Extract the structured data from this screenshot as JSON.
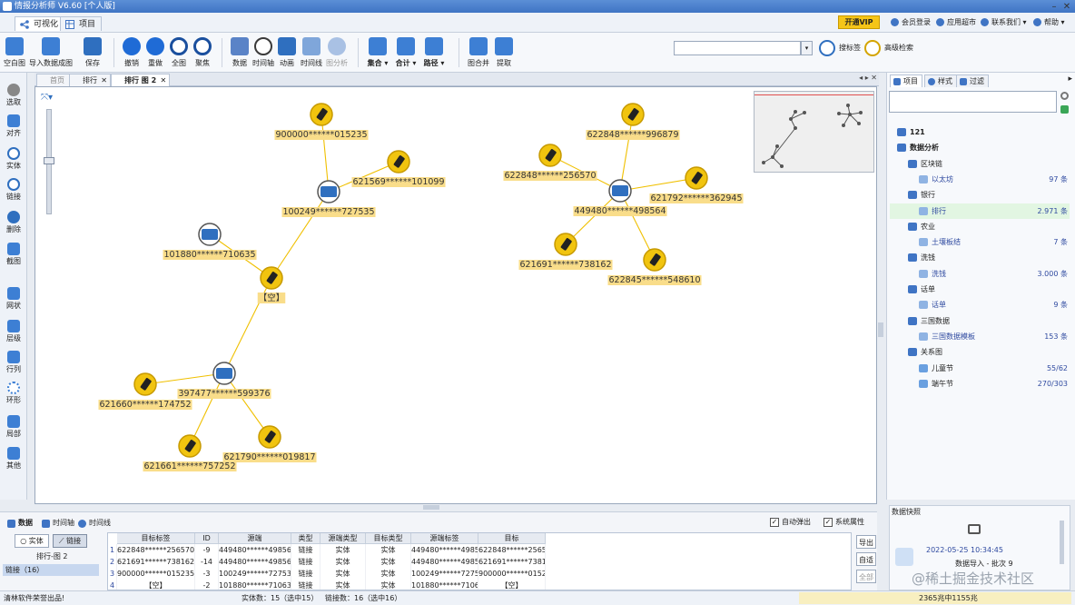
{
  "window": {
    "title": "情报分析师 V6.60 [个人版]"
  },
  "menubar": {
    "tabs": [
      {
        "label": "可视化"
      },
      {
        "label": "项目"
      }
    ],
    "vip": "开通VIP",
    "links": [
      {
        "label": "会员登录"
      },
      {
        "label": "应用超市"
      },
      {
        "label": "联系我们"
      },
      {
        "label": "帮助"
      }
    ]
  },
  "toolbar": {
    "buttons": [
      {
        "label": "空白图"
      },
      {
        "label": "导入数据成图"
      },
      {
        "label": "保存"
      },
      {
        "label": "撤销"
      },
      {
        "label": "重做"
      },
      {
        "label": "全图"
      },
      {
        "label": "聚焦"
      },
      {
        "label": "数据"
      },
      {
        "label": "时间轴"
      },
      {
        "label": "动画"
      },
      {
        "label": "时间线"
      },
      {
        "label": "图分析"
      },
      {
        "label": "集合"
      },
      {
        "label": "合计"
      },
      {
        "label": "路径"
      },
      {
        "label": "图合并"
      },
      {
        "label": "提取"
      }
    ],
    "search_value": "",
    "tag_search": "搜标签",
    "advanced_search": "高级检索"
  },
  "left_tools": [
    {
      "label": "选取"
    },
    {
      "label": "对齐"
    },
    {
      "label": "实体"
    },
    {
      "label": "链接"
    },
    {
      "label": "删除"
    },
    {
      "label": "截图"
    },
    {
      "label": "网状"
    },
    {
      "label": "层级"
    },
    {
      "label": "行列"
    },
    {
      "label": "环形"
    },
    {
      "label": "局部"
    },
    {
      "label": "其他"
    }
  ],
  "doc_tabs": [
    {
      "label": "首页"
    },
    {
      "label": "排行"
    },
    {
      "label": "排行 图 2"
    }
  ],
  "graph": {
    "nodes": [
      {
        "id": "n1",
        "label": "900000******015235",
        "type": "phone"
      },
      {
        "id": "n2",
        "label": "621569******101099",
        "type": "phone"
      },
      {
        "id": "n3",
        "label": "100249******727535",
        "type": "card"
      },
      {
        "id": "n4",
        "label": "101880******710635",
        "type": "card"
      },
      {
        "id": "n5",
        "label": "【空】",
        "type": "phone"
      },
      {
        "id": "n6",
        "label": "397477******599376",
        "type": "card"
      },
      {
        "id": "n7",
        "label": "621660******174752",
        "type": "phone"
      },
      {
        "id": "n8",
        "label": "621661******757252",
        "type": "phone"
      },
      {
        "id": "n9",
        "label": "621790******019817",
        "type": "phone"
      },
      {
        "id": "n10",
        "label": "622848******996879",
        "type": "phone"
      },
      {
        "id": "n11",
        "label": "622848******256570",
        "type": "phone"
      },
      {
        "id": "n12",
        "label": "449480******498564",
        "type": "card"
      },
      {
        "id": "n13",
        "label": "621792******362945",
        "type": "phone"
      },
      {
        "id": "n14",
        "label": "621691******738162",
        "type": "phone"
      },
      {
        "id": "n15",
        "label": "622845******548610",
        "type": "phone"
      }
    ]
  },
  "right_panel": {
    "tabs": [
      {
        "label": "项目"
      },
      {
        "label": "样式"
      },
      {
        "label": "过滤"
      }
    ],
    "tree": [
      {
        "label": "121",
        "count": ""
      },
      {
        "label": "数据分析",
        "count": ""
      },
      {
        "label": "区块链",
        "count": ""
      },
      {
        "label": "以太坊",
        "count": "97 条"
      },
      {
        "label": "银行",
        "count": ""
      },
      {
        "label": "排行",
        "count": "2.971 条"
      },
      {
        "label": "农业",
        "count": ""
      },
      {
        "label": "土壤板结",
        "count": "7 条"
      },
      {
        "label": "洗钱",
        "count": ""
      },
      {
        "label": "洗钱",
        "count": "3.000 条"
      },
      {
        "label": "话单",
        "count": ""
      },
      {
        "label": "话单",
        "count": "9 条"
      },
      {
        "label": "三国数据",
        "count": ""
      },
      {
        "label": "三国数据模板",
        "count": "153 条"
      },
      {
        "label": "关系图",
        "count": ""
      },
      {
        "label": "儿童节",
        "count": "55/62"
      },
      {
        "label": "端午节",
        "count": "270/303"
      }
    ],
    "snapshot": {
      "title": "数据快照",
      "time": "2022-05-25 10:34:45",
      "desc": "数据导入 - 批次 9"
    }
  },
  "bottom_panel": {
    "tabs": [
      {
        "label": "数据"
      },
      {
        "label": "时间轴"
      },
      {
        "label": "时间线"
      }
    ],
    "entity_btn": "实体",
    "link_btn": "链接",
    "graph_name": "排行-图 2",
    "link_list_item": "链接（16）",
    "auto_popup": "自动弹出",
    "system_attr": "系统属性",
    "columns": [
      "目标标签",
      "ID",
      "源端",
      "类型",
      "源端类型",
      "目标类型",
      "源端标签",
      "目标"
    ],
    "rows": [
      {
        "n": "1",
        "cells": [
          "622848******256570",
          "-9",
          "449480******498564",
          "链接",
          "实体",
          "实体",
          "449480******498564",
          "622848******256570"
        ]
      },
      {
        "n": "2",
        "cells": [
          "621691******738162",
          "-14",
          "449480******498564",
          "链接",
          "实体",
          "实体",
          "449480******498564",
          "621691******738162"
        ]
      },
      {
        "n": "3",
        "cells": [
          "900000******015235",
          "-3",
          "100249******727535",
          "链接",
          "实体",
          "实体",
          "100249******727535",
          "900000******015235"
        ]
      },
      {
        "n": "4",
        "cells": [
          "【空】",
          "-2",
          "101880******710635",
          "链接",
          "实体",
          "实体",
          "101880******710635",
          "【空】"
        ]
      }
    ],
    "side_buttons": [
      "导出",
      "自适",
      "全部"
    ]
  },
  "statusbar": {
    "left": "清林软件荣誉出品!",
    "entities": "实体数：15（选中15）",
    "links": "链接数：16（选中16）",
    "memory": "2365兆中1155兆"
  },
  "watermark": "@稀土掘金技术社区",
  "colors": {
    "node_fill": "#f1c40f",
    "node_border": "#c79a00",
    "label_bg": "#f9dd8a",
    "edge": "#f0c000",
    "card_fill": "#2f6fbf"
  }
}
